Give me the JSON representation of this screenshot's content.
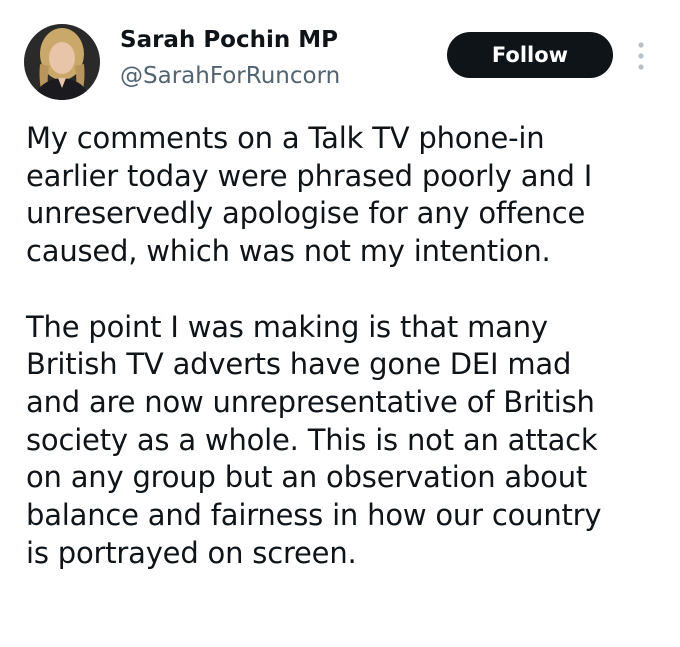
{
  "author": {
    "name": "Sarah Pochin MP",
    "handle": "@SarahForRuncorn",
    "avatar_icon": "profile-photo"
  },
  "actions": {
    "follow_label": "Follow",
    "more_icon": "vertical-ellipsis-icon"
  },
  "tweet": {
    "paragraph_1_lines": [
      "My comments on a Talk TV phone-in",
      "earlier today were phrased poorly and I",
      "unreservedly apologise for any offence",
      "caused, which was not my intention."
    ],
    "paragraph_2_lines": [
      "The point I was making is that many",
      "British TV adverts have gone DEI mad",
      "and are now unrepresentative of British",
      "society as a whole. This is not an attack",
      "on any group but an observation about",
      "balance and fairness in how our country",
      "is portrayed on screen."
    ]
  },
  "colors": {
    "text_primary": "#0f1419",
    "text_secondary": "#536471",
    "follow_button_bg": "#0f1419",
    "follow_button_text": "#ffffff"
  }
}
